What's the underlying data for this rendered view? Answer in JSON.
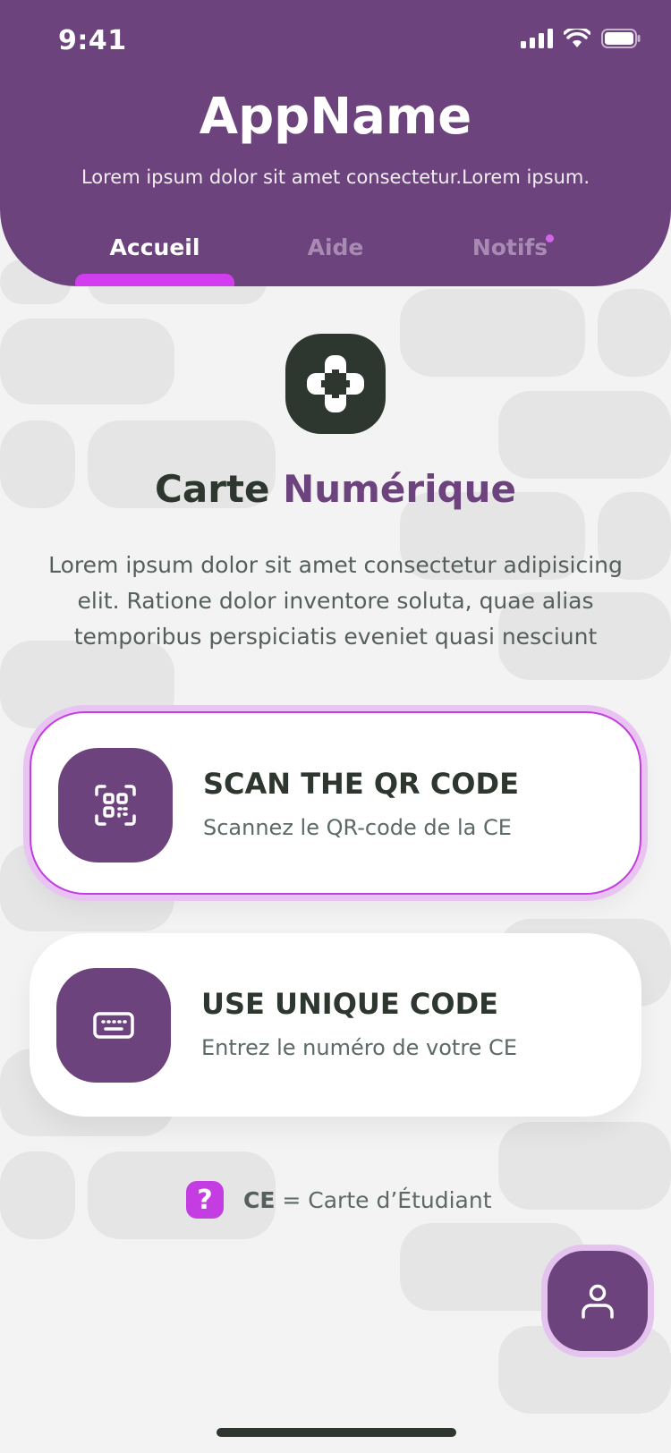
{
  "status_bar": {
    "time": "9:41"
  },
  "header": {
    "app_name": "AppName",
    "subtitle": "Lorem ipsum dolor sit amet consectetur.Lorem ipsum.",
    "tabs": [
      {
        "label": "Accueil",
        "active": true
      },
      {
        "label": "Aide",
        "active": false
      },
      {
        "label": "Notifs",
        "active": false,
        "has_dot": true
      }
    ]
  },
  "hero": {
    "icon": "gamepad-plus-icon",
    "title_part1": "Carte",
    "title_part2": "Numérique",
    "description": "Lorem ipsum dolor sit amet consectetur adipisicing elit. Ratione dolor inventore soluta, quae alias temporibus perspiciatis eveniet quasi nesciunt"
  },
  "options": [
    {
      "icon": "qr-code-icon",
      "title": "SCAN THE QR CODE",
      "subtitle": "Scannez le QR-code de la CE",
      "selected": true
    },
    {
      "icon": "keyboard-icon",
      "title": "USE UNIQUE CODE",
      "subtitle": "Entrez le numéro de votre CE",
      "selected": false
    }
  ],
  "footnote": {
    "icon": "question-icon",
    "abbr": "CE",
    "definition": "= Carte d’Étudiant"
  },
  "fab": {
    "icon": "user-icon"
  },
  "colors": {
    "primary": "#6c437c",
    "accent": "#c43de3",
    "dark": "#2d372f",
    "background": "#f4f3f4"
  }
}
